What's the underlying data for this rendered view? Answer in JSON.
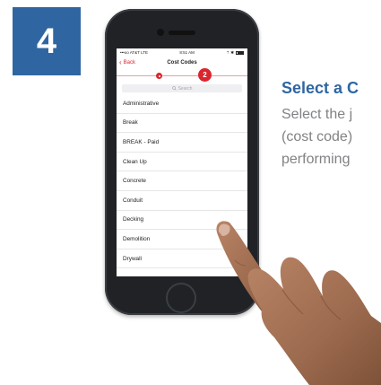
{
  "step": {
    "number": "4"
  },
  "phone": {
    "status": {
      "carrier": "•••oo AT&T LTE",
      "time": "8:51 AM",
      "right": "⇡ ✱"
    },
    "nav": {
      "back_label": "Back",
      "title": "Cost Codes"
    },
    "progress": {
      "current_step": "2"
    },
    "search": {
      "placeholder": "Search"
    },
    "cost_codes": [
      "Administrative",
      "Break",
      "BREAK - Paid",
      "Clean Up",
      "Concrete",
      "Conduit",
      "Decking",
      "Demolition",
      "Drywall"
    ]
  },
  "instructions": {
    "heading": "Select a C",
    "lines": [
      "Select the j",
      "(cost code)",
      "performing"
    ]
  },
  "colors": {
    "accent_blue": "#2f66a1",
    "accent_red": "#d9262e"
  },
  "icons": [
    "search-icon",
    "back-chevron-icon",
    "battery-icon"
  ]
}
